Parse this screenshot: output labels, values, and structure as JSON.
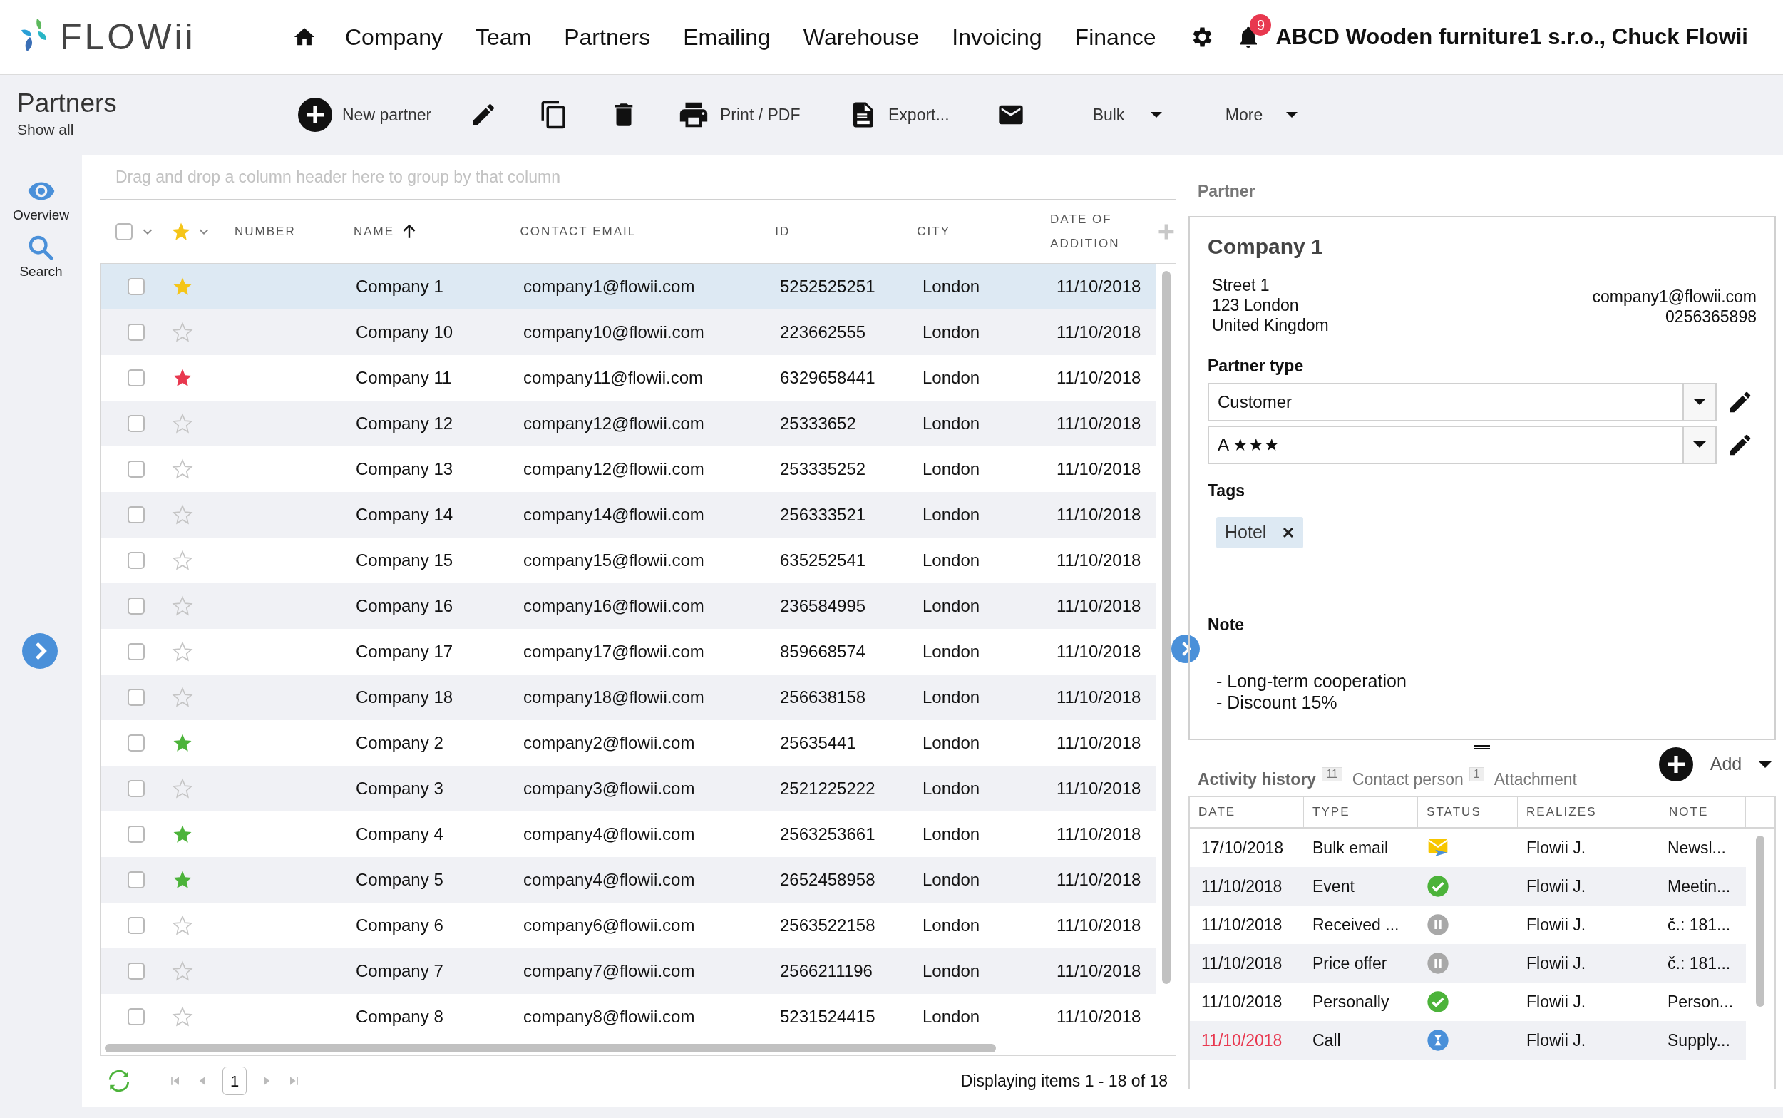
{
  "logo": "FLOWii",
  "nav": [
    "Company",
    "Team",
    "Partners",
    "Emailing",
    "Warehouse",
    "Invoicing",
    "Finance"
  ],
  "notifications": "9",
  "user": "ABCD Wooden furniture1 s.r.o., Chuck Flowii",
  "page": {
    "title": "Partners",
    "subtitle": "Show all"
  },
  "toolbar": [
    {
      "kind": "new",
      "label": "New partner"
    },
    {
      "kind": "edit"
    },
    {
      "kind": "copy"
    },
    {
      "kind": "delete"
    },
    {
      "kind": "print",
      "label": "Print / PDF"
    },
    {
      "kind": "export",
      "label": "Export..."
    },
    {
      "kind": "email"
    },
    {
      "kind": "menu",
      "label": "Bulk"
    },
    {
      "kind": "menu",
      "label": "More"
    }
  ],
  "sidebar": [
    {
      "kind": "eye",
      "label": "Overview"
    },
    {
      "kind": "search",
      "label": "Search"
    }
  ],
  "grid": {
    "all_checked": false,
    "group_hint": "Drag and drop a column header here to group by that column",
    "columns": [
      {
        "label": "NUMBER",
        "sorted": false
      },
      {
        "label": "NAME",
        "sorted": true
      },
      {
        "label": "CONTACT EMAIL",
        "sorted": false
      },
      {
        "label": "ID",
        "sorted": false
      },
      {
        "label": "CITY",
        "sorted": false
      },
      {
        "label": "DATE OF ADDITION",
        "sorted": false
      }
    ],
    "rows": [
      {
        "name": "Company 1",
        "email": "company1@flowii.com",
        "id": "5252525251",
        "checked": false,
        "city": "London",
        "date": "11/10/2018",
        "starred": true,
        "color": "#f5c518",
        "selected": true
      },
      {
        "name": "Company 10",
        "email": "company10@flowii.com",
        "id": "223662555",
        "checked": false,
        "city": "London",
        "date": "11/10/2018",
        "starred": false,
        "selected": false
      },
      {
        "name": "Company 11",
        "email": "company11@flowii.com",
        "id": "6329658441",
        "checked": false,
        "city": "London",
        "date": "11/10/2018",
        "starred": true,
        "color": "#e8384f",
        "selected": false
      },
      {
        "name": "Company 12",
        "email": "company12@flowii.com",
        "id": "25333652",
        "checked": false,
        "city": "London",
        "date": "11/10/2018",
        "starred": false,
        "selected": false
      },
      {
        "name": "Company 13",
        "email": "company12@flowii.com",
        "id": "253335252",
        "checked": false,
        "city": "London",
        "date": "11/10/2018",
        "starred": false,
        "selected": false
      },
      {
        "name": "Company 14",
        "email": "company14@flowii.com",
        "id": "256333521",
        "checked": false,
        "city": "London",
        "date": "11/10/2018",
        "starred": false,
        "selected": false
      },
      {
        "name": "Company 15",
        "email": "company15@flowii.com",
        "id": "635252541",
        "checked": false,
        "city": "London",
        "date": "11/10/2018",
        "starred": false,
        "selected": false
      },
      {
        "name": "Company 16",
        "email": "company16@flowii.com",
        "id": "236584995",
        "checked": false,
        "city": "London",
        "date": "11/10/2018",
        "starred": false,
        "selected": false
      },
      {
        "name": "Company 17",
        "email": "company17@flowii.com",
        "id": "859668574",
        "checked": false,
        "city": "London",
        "date": "11/10/2018",
        "starred": false,
        "selected": false
      },
      {
        "name": "Company 18",
        "email": "company18@flowii.com",
        "id": "256638158",
        "checked": false,
        "city": "London",
        "date": "11/10/2018",
        "starred": false,
        "selected": false
      },
      {
        "name": "Company 2",
        "email": "company2@flowii.com",
        "id": "25635441",
        "checked": false,
        "city": "London",
        "date": "11/10/2018",
        "starred": true,
        "color": "#4cb33a",
        "selected": false
      },
      {
        "name": "Company 3",
        "email": "company3@flowii.com",
        "id": "2521225222",
        "checked": false,
        "city": "London",
        "date": "11/10/2018",
        "starred": false,
        "selected": false
      },
      {
        "name": "Company 4",
        "email": "company4@flowii.com",
        "id": "2563253661",
        "checked": false,
        "city": "London",
        "date": "11/10/2018",
        "starred": true,
        "color": "#4cb33a",
        "selected": false
      },
      {
        "name": "Company 5",
        "email": "company4@flowii.com",
        "id": "2652458958",
        "checked": false,
        "city": "London",
        "date": "11/10/2018",
        "starred": true,
        "color": "#4cb33a",
        "selected": false
      },
      {
        "name": "Company 6",
        "email": "company6@flowii.com",
        "id": "2563522158",
        "checked": false,
        "city": "London",
        "date": "11/10/2018",
        "starred": false,
        "selected": false
      },
      {
        "name": "Company 7",
        "email": "company7@flowii.com",
        "id": "2566211196",
        "checked": false,
        "city": "London",
        "date": "11/10/2018",
        "starred": false,
        "selected": false
      },
      {
        "name": "Company 8",
        "email": "company8@flowii.com",
        "id": "5231524415",
        "checked": false,
        "city": "London",
        "date": "11/10/2018",
        "starred": false,
        "selected": false
      }
    ],
    "page": "1",
    "summary": "Displaying items 1 - 18 of 18"
  },
  "partner": {
    "section": "Partner",
    "name": "Company 1",
    "address": [
      "Street 1",
      "123 London",
      "United Kingdom"
    ],
    "email": "company1@flowii.com",
    "phone": "0256365898",
    "type_label": "Partner type",
    "type": "Customer",
    "rating": "A ★★★",
    "tags_label": "Tags",
    "tags": [
      "Hotel"
    ],
    "note_label": "Note",
    "note": [
      "- Long-term cooperation",
      "- Discount 15%"
    ]
  },
  "activity": {
    "tabs": [
      {
        "label": "Activity history",
        "count": "11",
        "selected": true
      },
      {
        "label": "Contact person",
        "count": "1",
        "selected": false
      },
      {
        "label": "Attachment",
        "selected": false
      }
    ],
    "add": "Add",
    "columns": [
      "DATE",
      "TYPE",
      "STATUS",
      "REALIZES",
      "NOTE"
    ],
    "rows": [
      {
        "date": "17/10/2018",
        "overdue": false,
        "type": "Bulk email",
        "kind": "email",
        "realizes": "Flowii J.",
        "note": "Newsl..."
      },
      {
        "date": "11/10/2018",
        "overdue": false,
        "type": "Event",
        "kind": "done",
        "realizes": "Flowii J.",
        "note": "Meetin..."
      },
      {
        "date": "11/10/2018",
        "overdue": false,
        "type": "Received ...",
        "kind": "paused",
        "realizes": "Flowii J.",
        "note": "č.: 181..."
      },
      {
        "date": "11/10/2018",
        "overdue": false,
        "type": "Price offer",
        "kind": "paused",
        "realizes": "Flowii J.",
        "note": "č.: 181..."
      },
      {
        "date": "11/10/2018",
        "overdue": false,
        "type": "Personally",
        "kind": "done",
        "realizes": "Flowii J.",
        "note": "Person..."
      },
      {
        "date": "11/10/2018",
        "overdue": true,
        "type": "Call",
        "kind": "pending",
        "realizes": "Flowii J.",
        "note": "Supply..."
      }
    ]
  }
}
